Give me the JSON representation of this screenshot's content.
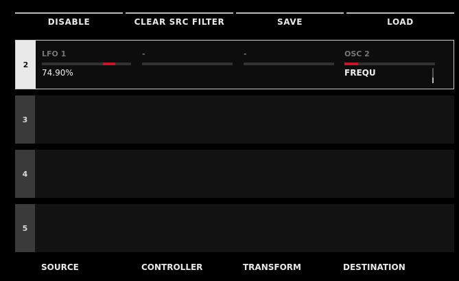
{
  "toolbar": {
    "disable": "DISABLE",
    "clear_src_filter": "CLEAR SRC FILTER",
    "save": "SAVE",
    "load": "LOAD"
  },
  "slots": [
    {
      "number": "2",
      "active": true,
      "source": {
        "label": "LFO 1",
        "value": "74.90%",
        "level": 0.75
      },
      "controller": {
        "label": "-"
      },
      "transform": {
        "label": "-"
      },
      "destination": {
        "label": "OSC 2",
        "value": "FREQU"
      }
    },
    {
      "number": "3"
    },
    {
      "number": "4"
    },
    {
      "number": "5"
    }
  ],
  "footer": {
    "source": "SOURCE",
    "controller": "CONTROLLER",
    "transform": "TRANSFORM",
    "destination": "DESTINATION"
  },
  "colors": {
    "accent": "#c2182b",
    "background": "#000000",
    "slot": "#121212"
  }
}
